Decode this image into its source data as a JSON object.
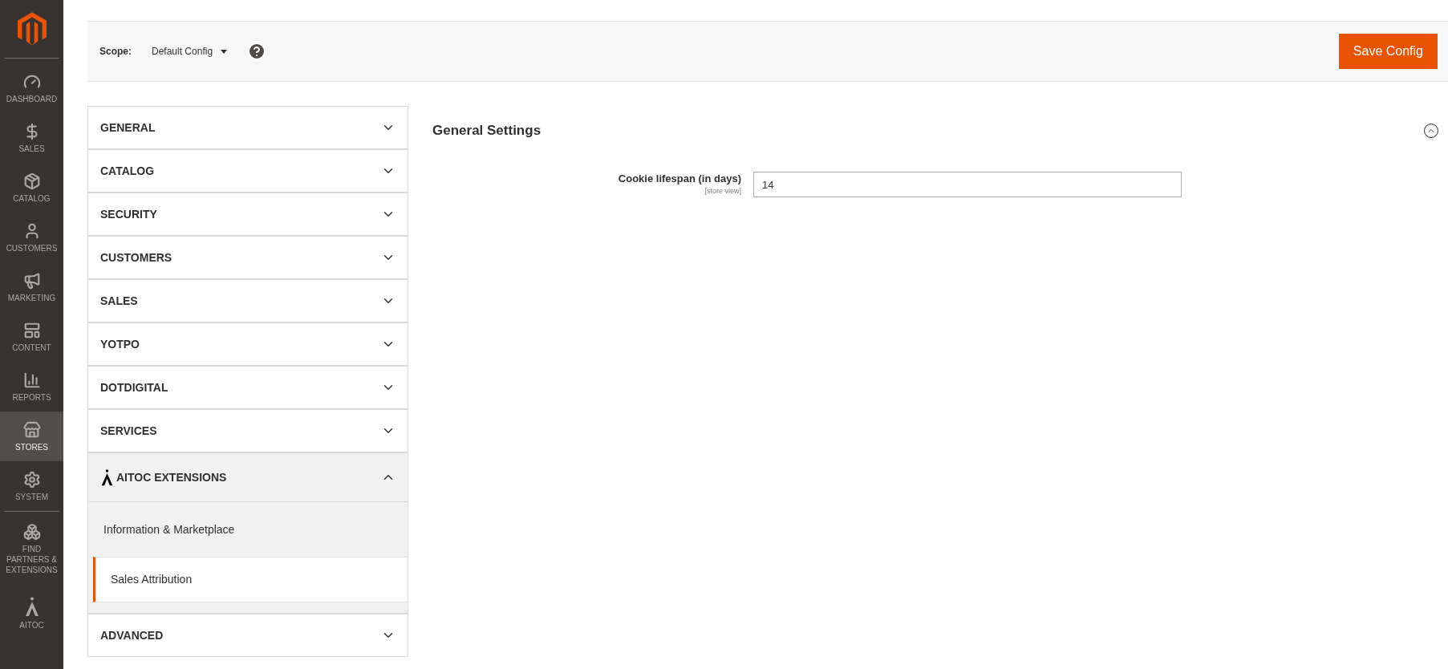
{
  "sidebar": {
    "items": [
      {
        "label": "DASHBOARD",
        "selected": false
      },
      {
        "label": "SALES",
        "selected": false
      },
      {
        "label": "CATALOG",
        "selected": false
      },
      {
        "label": "CUSTOMERS",
        "selected": false
      },
      {
        "label": "MARKETING",
        "selected": false
      },
      {
        "label": "CONTENT",
        "selected": false
      },
      {
        "label": "REPORTS",
        "selected": false
      },
      {
        "label": "STORES",
        "selected": true
      },
      {
        "label": "SYSTEM",
        "selected": false
      },
      {
        "label": "FIND PARTNERS & EXTENSIONS",
        "selected": false
      },
      {
        "label": "AITOC",
        "selected": false
      }
    ]
  },
  "scope_bar": {
    "label": "Scope:",
    "scope": "Default Config",
    "save_button": "Save Config"
  },
  "config_tabs": [
    {
      "label": "GENERAL",
      "expanded": false
    },
    {
      "label": "CATALOG",
      "expanded": false
    },
    {
      "label": "SECURITY",
      "expanded": false
    },
    {
      "label": "CUSTOMERS",
      "expanded": false
    },
    {
      "label": "SALES",
      "expanded": false
    },
    {
      "label": "YOTPO",
      "expanded": false
    },
    {
      "label": "DOTDIGITAL",
      "expanded": false
    },
    {
      "label": "SERVICES",
      "expanded": false
    },
    {
      "label": "AITOC EXTENSIONS",
      "expanded": true,
      "children": [
        {
          "label": "Information & Marketplace",
          "selected": false
        },
        {
          "label": "Sales Attribution",
          "selected": true
        }
      ]
    },
    {
      "label": "ADVANCED",
      "expanded": false
    }
  ],
  "section": {
    "title": "General Settings",
    "expanded": true,
    "fields": [
      {
        "label": "Cookie lifespan (in days)",
        "scope": "[store view]",
        "value": "14"
      }
    ]
  }
}
